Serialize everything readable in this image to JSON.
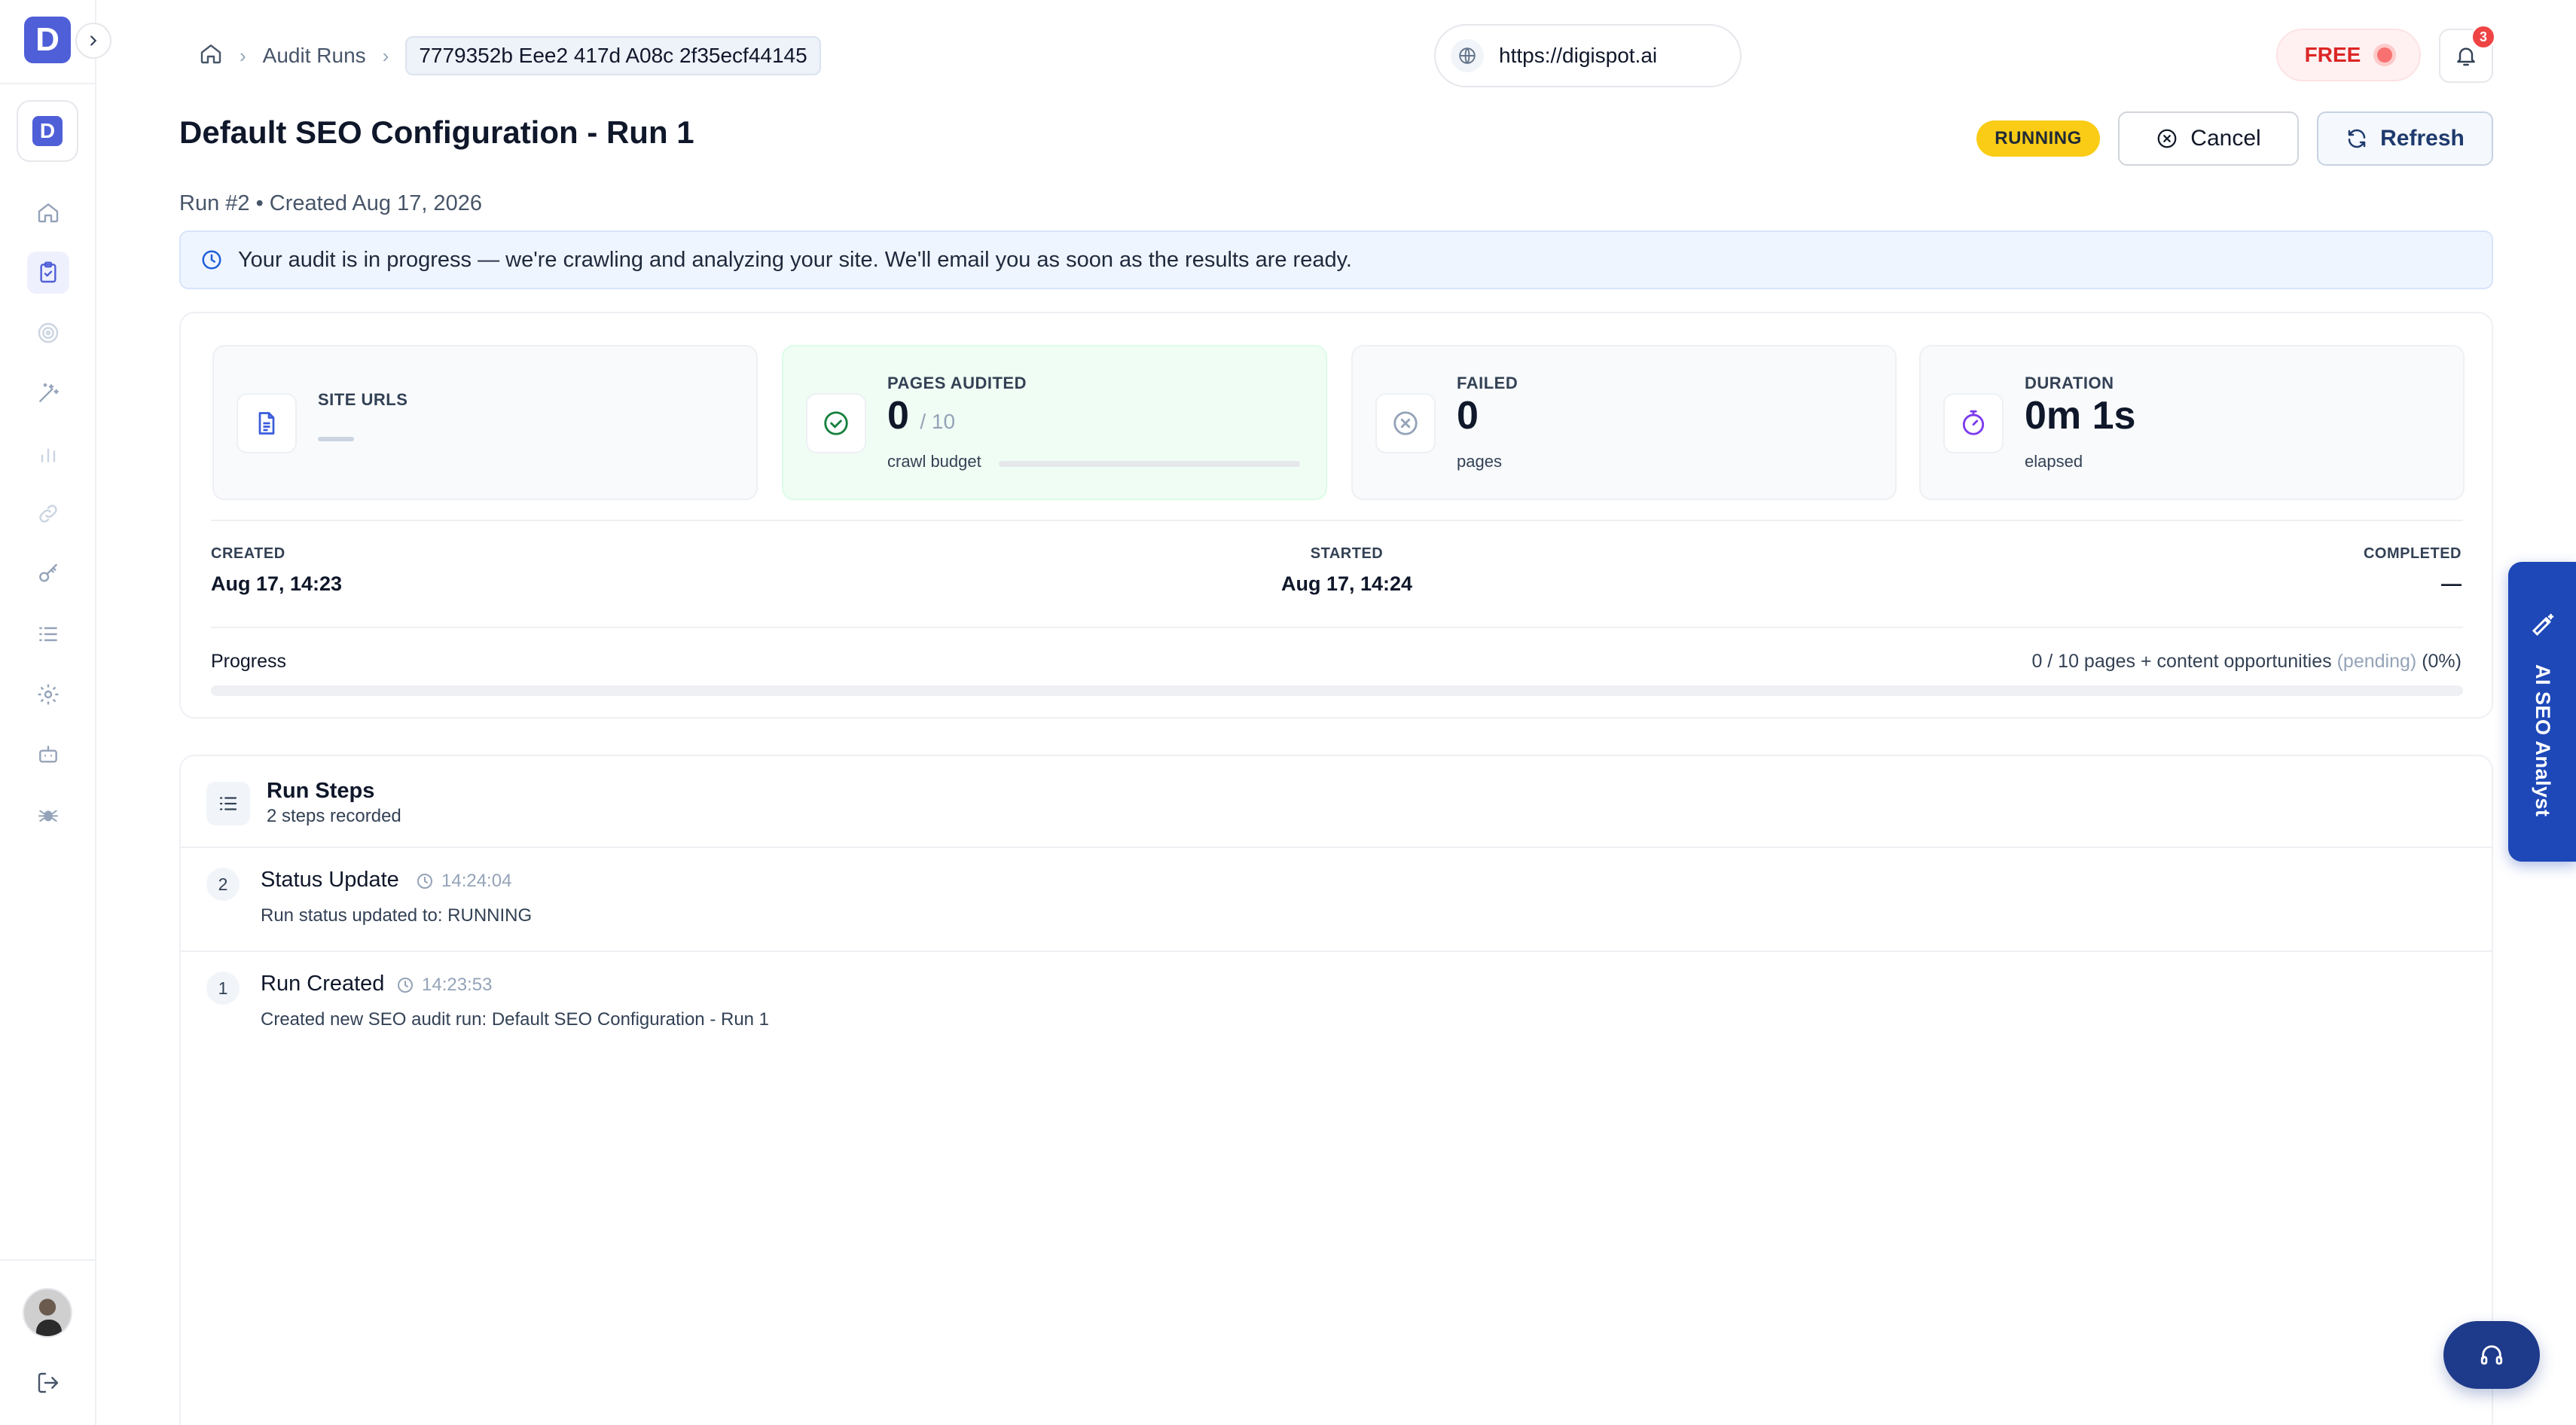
{
  "sidebar": {
    "logo_letter": "D",
    "workspace_letter": "D",
    "items": [
      {
        "name": "home-icon"
      },
      {
        "name": "clipboard-check-icon",
        "active": true
      },
      {
        "name": "target-icon"
      },
      {
        "name": "magic-wand-icon"
      },
      {
        "name": "bar-chart-icon"
      },
      {
        "name": "link-icon"
      },
      {
        "name": "key-icon"
      },
      {
        "name": "list-icon"
      },
      {
        "name": "gear-icon"
      },
      {
        "name": "bot-icon"
      },
      {
        "name": "spider-icon"
      }
    ]
  },
  "header": {
    "breadcrumb": {
      "home_icon": "home-icon",
      "audit_runs": "Audit Runs",
      "current": "7779352b Eee2 417d A08c 2f35ecf44145"
    },
    "site_url": "https://digispot.ai",
    "plan_badge": "FREE",
    "notification_count": "3"
  },
  "run": {
    "title": "Default SEO Configuration - Run 1",
    "status": "RUNNING",
    "cancel_label": "Cancel",
    "refresh_label": "Refresh",
    "meta": "Run #2 • Created Aug 17, 2026",
    "alert": "Your audit is in progress — we're crawling and analyzing your site. We'll email you as soon as the results are ready."
  },
  "stats": {
    "site_urls": {
      "label": "SITE URLS"
    },
    "pages_audited": {
      "label": "PAGES AUDITED",
      "value": "0",
      "total": "/ 10",
      "sub": "crawl budget",
      "fraction": 0
    },
    "failed": {
      "label": "FAILED",
      "value": "0",
      "sub": "pages"
    },
    "duration": {
      "label": "DURATION",
      "value": "0m 1s",
      "sub": "elapsed"
    }
  },
  "timeline": {
    "created": {
      "label": "CREATED",
      "value": "Aug 17, 14:23"
    },
    "started": {
      "label": "STARTED",
      "value": "Aug 17, 14:24"
    },
    "completed": {
      "label": "COMPLETED",
      "value": "—"
    }
  },
  "progress": {
    "label": "Progress",
    "detail": "0 / 10 pages + content opportunities",
    "pending": "(pending)",
    "percent_text": "(0%)",
    "percent": 0
  },
  "steps": {
    "title": "Run Steps",
    "subtitle": "2 steps recorded",
    "items": [
      {
        "num": "2",
        "title": "Status Update",
        "time": "14:24:04",
        "desc": "Run status updated to: RUNNING"
      },
      {
        "num": "1",
        "title": "Run Created",
        "time": "14:23:53",
        "desc": "Created new SEO audit run: Default SEO Configuration - Run 1"
      }
    ]
  },
  "floating": {
    "ai_tab_label": "AI SEO Analyst",
    "support_icon": "headset-icon"
  },
  "colors": {
    "brand": "#4f5fd8",
    "running": "#facc15",
    "free_text": "#dc2626",
    "ai_tab": "#1e48b8"
  }
}
